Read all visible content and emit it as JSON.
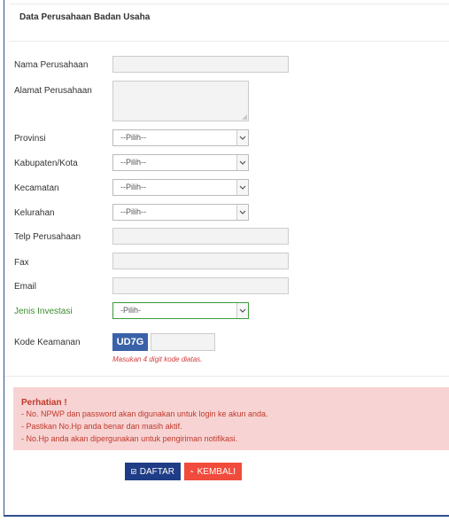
{
  "panel": {
    "title": "Data Perusahaan Badan Usaha"
  },
  "form": {
    "nama_label": "Nama Perusahaan",
    "alamat_label": "Alamat Perusahaan",
    "provinsi_label": "Provinsi",
    "provinsi_value": "--Pilih--",
    "kabupaten_label": "Kabupaten/Kota",
    "kabupaten_value": "--Pilih--",
    "kecamatan_label": "Kecamatan",
    "kecamatan_value": "--Pilih--",
    "kelurahan_label": "Kelurahan",
    "kelurahan_value": "--Pilih--",
    "telp_label": "Telp Perusahaan",
    "fax_label": "Fax",
    "email_label": "Email",
    "investasi_label": "Jenis Investasi",
    "investasi_value": "-Pilih-",
    "kode_label": "Kode Keamanan",
    "captcha_code": "UD7G",
    "captcha_hint": "Masukan 4 digit kode diatas."
  },
  "alert": {
    "title": "Perhatian !",
    "lines": [
      "- No. NPWP dan password akan digunakan untuk login ke akun anda.",
      "- Pastikan No.Hp anda benar dan masih aktif.",
      "- No.Hp anda akan dipergunakan untuk pengiriman notifikasi."
    ]
  },
  "buttons": {
    "daftar": "DAFTAR",
    "kembali": "KEMBALI"
  },
  "colors": {
    "primary": "#1f3d86",
    "danger": "#f04b3c",
    "alert_bg": "#f7d3d3",
    "success": "#3c8d2f"
  }
}
